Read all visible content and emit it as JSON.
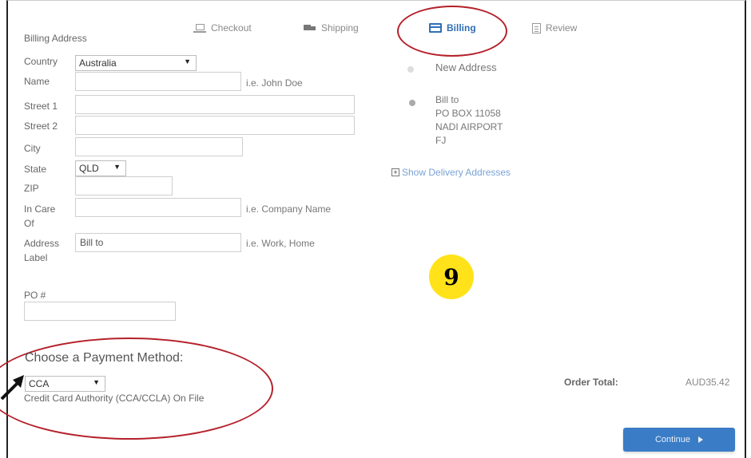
{
  "steps": [
    {
      "label": "Checkout",
      "icon": "cart-icon"
    },
    {
      "label": "Shipping",
      "icon": "truck-icon"
    },
    {
      "label": "Billing",
      "icon": "credit-card-icon"
    },
    {
      "label": "Review",
      "icon": "document-icon"
    }
  ],
  "billing": {
    "title": "Billing Address",
    "country_label": "Country",
    "country_value": "Australia",
    "name_label": "Name",
    "name_value": "",
    "name_hint": "i.e. John Doe",
    "street1_label": "Street 1",
    "street1_value": "",
    "street2_label": "Street 2",
    "street2_value": "",
    "city_label": "City",
    "city_value": "",
    "state_label": "State",
    "state_value": "QLD",
    "zip_label": "ZIP",
    "zip_value": "",
    "incare_label1": "In Care",
    "incare_label2": "Of",
    "incare_value": "",
    "incare_hint": "i.e. Company Name",
    "addrlabel_label1": "Address",
    "addrlabel_label2": "Label",
    "addrlabel_value": "Bill to",
    "addrlabel_hint": "i.e. Work, Home",
    "po_label": "PO #",
    "po_value": ""
  },
  "address_options": {
    "new_address": "New Address",
    "bill_to_lines": [
      "Bill to",
      "PO BOX 11058",
      "NADI AIRPORT",
      "FJ"
    ],
    "show_delivery": "Show Delivery Addresses"
  },
  "annotation": {
    "step_number": "9"
  },
  "payment": {
    "heading": "Choose a Payment Method:",
    "method_value": "CCA",
    "method_note": "Credit Card Authority (CCA/CCLA) On File"
  },
  "order": {
    "total_label": "Order Total:",
    "total_value": "AUD35.42"
  },
  "actions": {
    "continue_label": "Continue"
  },
  "colors": {
    "accent": "#2f6fb6",
    "button": "#3a7cc6",
    "annotation_ring": "#b5202a",
    "badge": "#ffe21a"
  }
}
